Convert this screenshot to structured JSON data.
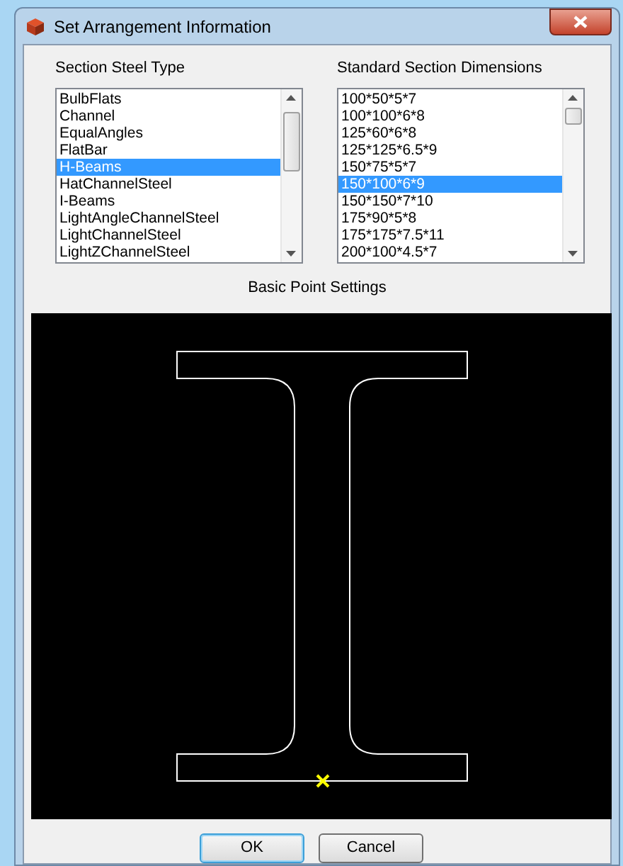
{
  "window": {
    "title": "Set Arrangement Information"
  },
  "section_steel_type": {
    "label": "Section Steel Type",
    "items": [
      {
        "text": "BulbFlats",
        "selected": false
      },
      {
        "text": "Channel",
        "selected": false
      },
      {
        "text": "EqualAngles",
        "selected": false
      },
      {
        "text": "FlatBar",
        "selected": false
      },
      {
        "text": "H-Beams",
        "selected": true
      },
      {
        "text": "HatChannelSteel",
        "selected": false
      },
      {
        "text": "I-Beams",
        "selected": false
      },
      {
        "text": "LightAngleChannelSteel",
        "selected": false
      },
      {
        "text": "LightChannelSteel",
        "selected": false
      },
      {
        "text": "LightZChannelSteel",
        "selected": false
      }
    ]
  },
  "standard_section_dimensions": {
    "label": "Standard Section Dimensions",
    "items": [
      {
        "text": "100*50*5*7",
        "selected": false
      },
      {
        "text": "100*100*6*8",
        "selected": false
      },
      {
        "text": "125*60*6*8",
        "selected": false
      },
      {
        "text": "125*125*6.5*9",
        "selected": false
      },
      {
        "text": "150*75*5*7",
        "selected": false
      },
      {
        "text": "150*100*6*9",
        "selected": true
      },
      {
        "text": "150*150*7*10",
        "selected": false
      },
      {
        "text": "175*90*5*8",
        "selected": false
      },
      {
        "text": "175*175*7.5*11",
        "selected": false
      },
      {
        "text": "200*100*4.5*7",
        "selected": false
      }
    ]
  },
  "basic_point_settings": {
    "label": "Basic Point Settings"
  },
  "buttons": [
    {
      "label": "OK",
      "focused": true
    },
    {
      "label": "Cancel",
      "focused": false
    }
  ]
}
